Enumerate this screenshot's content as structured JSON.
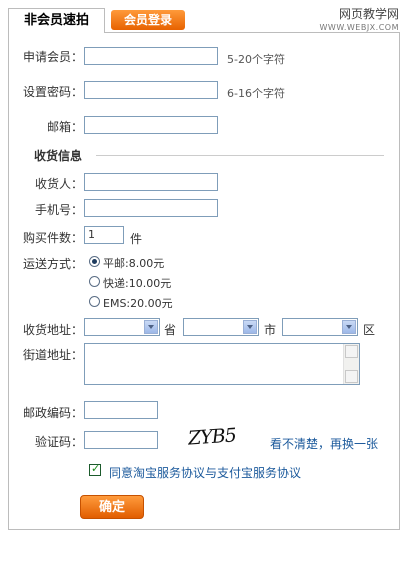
{
  "tabs": {
    "active": "非会员速拍",
    "login": "会员登录"
  },
  "watermark": {
    "line1": "网页教学网",
    "line2": "WWW.WEBJX.COM"
  },
  "form": {
    "member_label": "申请会员：",
    "member_hint": "5-20个字符",
    "password_label": "设置密码：",
    "password_hint": "6-16个字符",
    "email_label": "邮箱：",
    "section_title": "收货信息",
    "receiver_label": "收货人：",
    "phone_label": "手机号：",
    "qty_label": "购买件数：",
    "qty_value": "1",
    "qty_unit": "件",
    "shipping_label": "运送方式：",
    "shipping_options": [
      "平邮:8.00元",
      "快递:10.00元",
      "EMS:20.00元"
    ],
    "shipping_selected": 0,
    "address_label": "收货地址：",
    "province_suffix": "省",
    "city_suffix": "市",
    "district_suffix": "区",
    "street_label": "街道地址：",
    "zip_label": "邮政编码：",
    "captcha_label": "验证码：",
    "captcha_text": "ZYB5",
    "captcha_refresh": "看不清楚，再换一张",
    "agree_text": "同意淘宝服务协议与支付宝服务协议",
    "agree_checked": true,
    "submit_label": "确定"
  }
}
